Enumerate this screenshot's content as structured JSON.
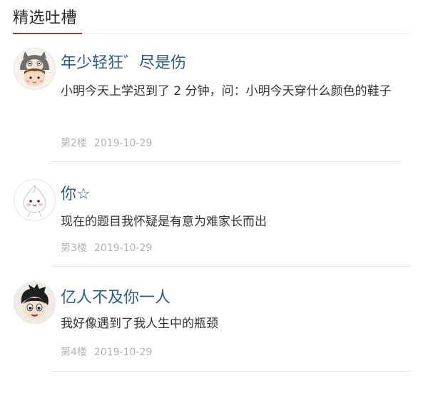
{
  "section": {
    "title": "精选吐槽"
  },
  "comments": [
    {
      "avatar_icon": "totoro-hat-girl-avatar-icon",
      "nickname": "年少轻狂゛尽是伤",
      "text": "小明今天上学迟到了 2 分钟，问：小明今天穿什么颜色的鞋子",
      "floor": "第2楼",
      "date": "2019-10-29"
    },
    {
      "avatar_icon": "white-bun-character-avatar-icon",
      "nickname": "你☆",
      "text": "现在的题目我怀疑是有意为难家长而出",
      "floor": "第3楼",
      "date": "2019-10-29"
    },
    {
      "avatar_icon": "astro-boy-avatar-icon",
      "nickname": "亿人不及你一人",
      "text": "我好像遇到了我人生中的瓶颈",
      "floor": "第4楼",
      "date": "2019-10-29"
    }
  ]
}
